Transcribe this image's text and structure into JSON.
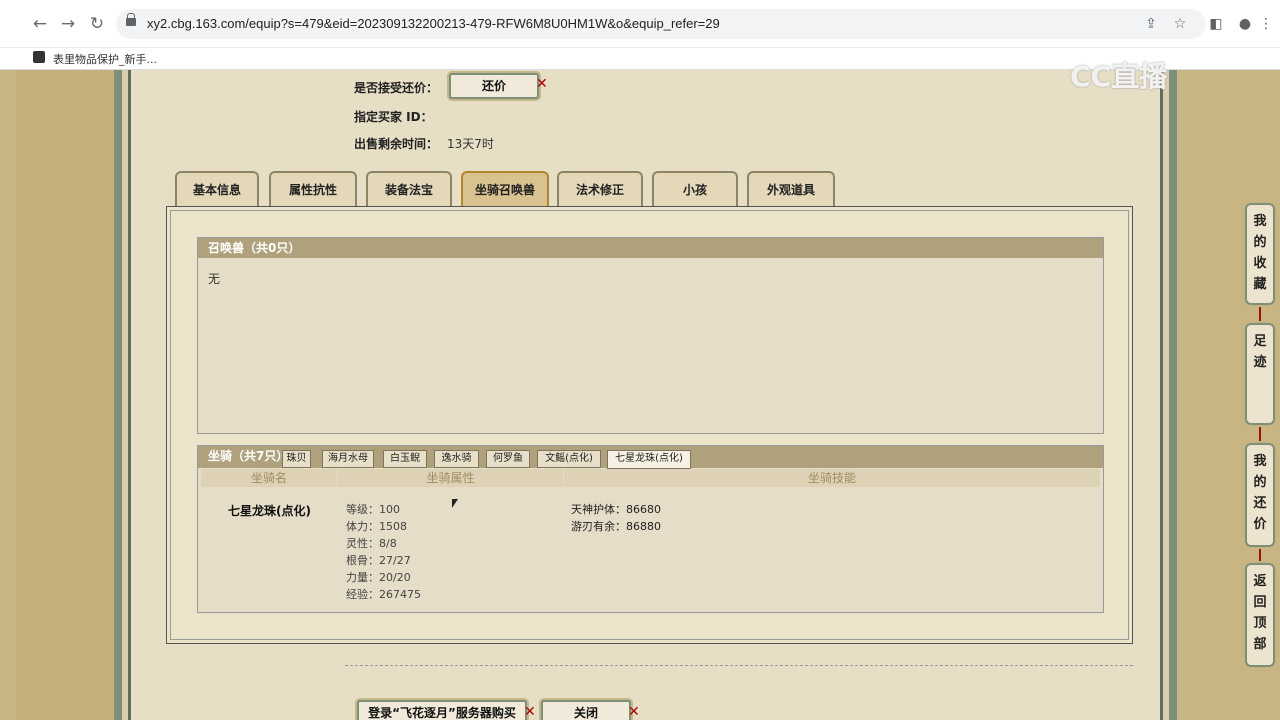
{
  "browser": {
    "url": "xy2.cbg.163.com/equip?s=479&eid=202309132200213-479-RFW6M8U0HM1W&o&equip_refer=29",
    "bookmark": "表里物品保护_新手..."
  },
  "watermark": "CC直播",
  "sale_info": {
    "accept_counter_label": "是否接受还价：",
    "counter_button": "还价",
    "buyer_id_label": "指定买家 ID：",
    "time_left_label": "出售剩余时间：",
    "time_left_value": "13天7时"
  },
  "tabs": [
    "基本信息",
    "属性抗性",
    "装备法宝",
    "坐骑召唤兽",
    "法术修正",
    "小孩",
    "外观道具"
  ],
  "active_tab": "坐骑召唤兽",
  "summons": {
    "header": "召唤兽（共0只）",
    "empty_text": "无"
  },
  "mounts": {
    "header": "坐骑（共7只）",
    "tabs": [
      "珠贝",
      "海月水母",
      "白玉鲵",
      "逸水骑",
      "何罗鱼",
      "文鳐(点化)",
      "七星龙珠(点化)"
    ],
    "active_tab": "七星龙珠(点化)",
    "columns": [
      "坐骑名",
      "坐骑属性",
      "坐骑技能"
    ],
    "name": "七星龙珠(点化)",
    "attributes": [
      "等级：100",
      "体力：1508",
      "灵性：8/8",
      "根骨：27/27",
      "力量：20/20",
      "经验：267475"
    ],
    "skills": [
      "天神护体：86680",
      "游刃有余：86880"
    ]
  },
  "footer": {
    "login_button": "登录“飞花逐月”服务器购买",
    "close_button": "关闭"
  },
  "side_nav": [
    "我的收藏",
    "足迹",
    "我的还价",
    "返回顶部"
  ]
}
